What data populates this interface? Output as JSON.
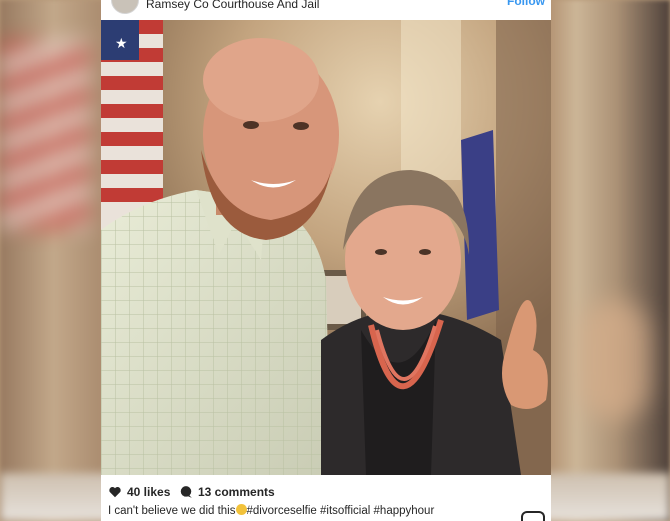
{
  "post": {
    "location": "Ramsey Co Courthouse And Jail",
    "follow_label": "Follow",
    "likes_label": "40 likes",
    "comments_label": "13 comments",
    "caption_prefix": "I can't believe we did this",
    "hashtags": [
      "#divorceselfie",
      "#itsofficial",
      "#happyhour"
    ]
  },
  "colors": {
    "accent": "#3897f0",
    "text": "#262626",
    "card_bg": "#ffffff"
  },
  "icons": {
    "likes": "heart-icon",
    "comments": "comment-bubble-icon",
    "caption_emoji": "worried-face-emoji-icon",
    "app": "instagram-icon"
  }
}
